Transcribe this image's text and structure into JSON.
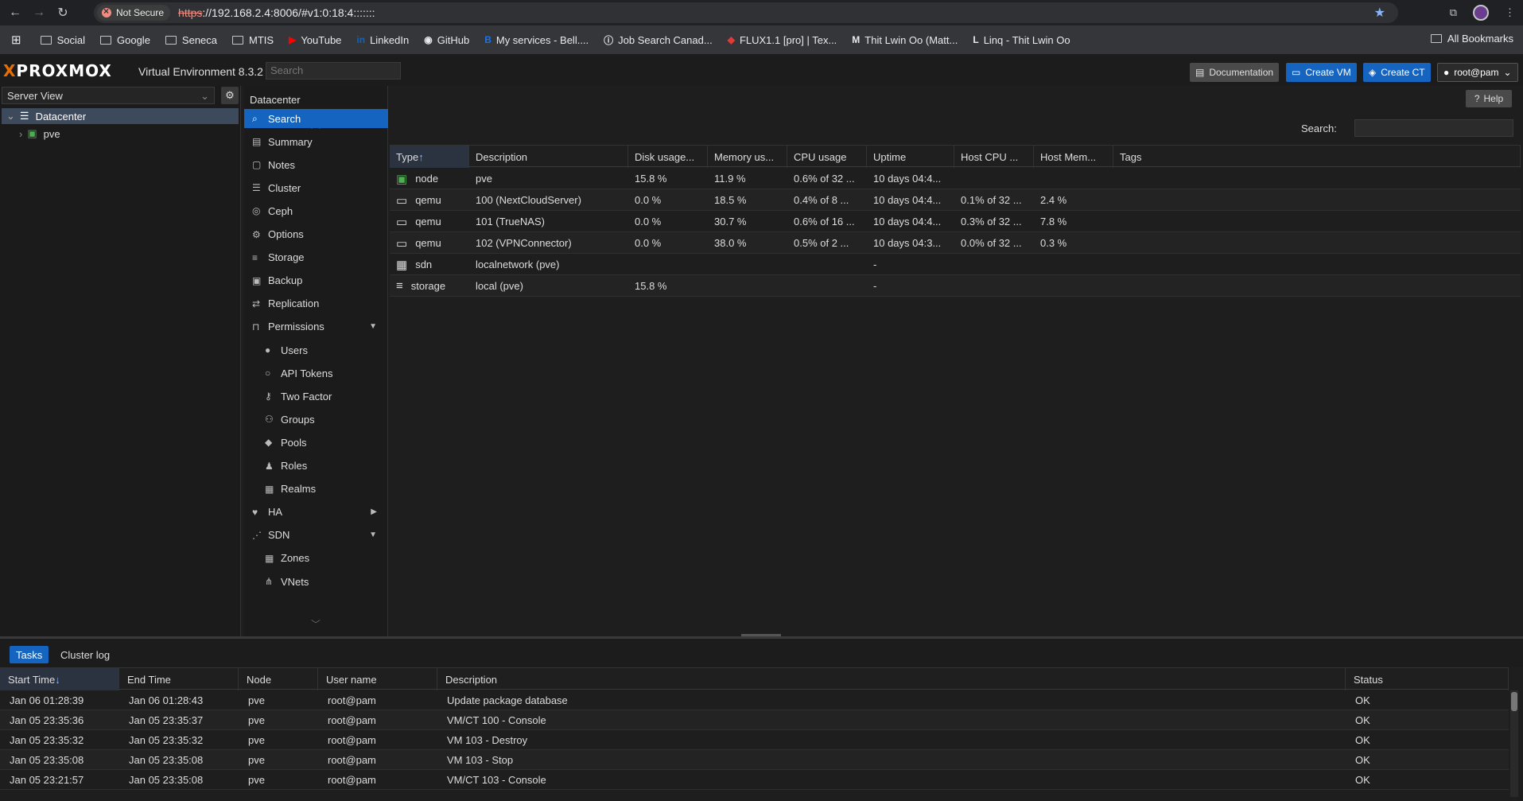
{
  "browser": {
    "not_secure": "Not Secure",
    "url_https": "https",
    "url_rest": "://192.168.2.4:8006/#v1:0:18:4:::::::",
    "bookmarks": [
      {
        "label": "Social",
        "icon": "folder-icon"
      },
      {
        "label": "Google",
        "icon": "folder-icon"
      },
      {
        "label": "Seneca",
        "icon": "folder-icon"
      },
      {
        "label": "MTIS",
        "icon": "folder-icon"
      },
      {
        "label": "YouTube",
        "icon": "youtube-icon"
      },
      {
        "label": "LinkedIn",
        "icon": "linkedin-icon"
      },
      {
        "label": "GitHub",
        "icon": "github-icon"
      },
      {
        "label": "My services - Bell....",
        "icon": "bell-icon"
      },
      {
        "label": "Job Search Canad...",
        "icon": "info-icon"
      },
      {
        "label": "FLUX1.1 [pro] | Tex...",
        "icon": "flux-icon"
      },
      {
        "label": "Thit Lwin Oo (Matt...",
        "icon": "m-icon"
      },
      {
        "label": "Linq - Thit Lwin Oo",
        "icon": "linq-icon"
      }
    ],
    "all_bookmarks": "All Bookmarks"
  },
  "header": {
    "logo": "PROXMOX",
    "version": "Virtual Environment 8.3.2",
    "search_placeholder": "Search",
    "documentation": "Documentation",
    "create_vm": "Create VM",
    "create_ct": "Create CT",
    "user": "root@pam"
  },
  "tree": {
    "view": "Server View",
    "datacenter": "Datacenter",
    "node": "pve"
  },
  "nav": {
    "title": "Datacenter",
    "help": "Help",
    "items": [
      {
        "label": "Search",
        "icon": "search-icon",
        "active": true
      },
      {
        "label": "Summary",
        "icon": "book-icon"
      },
      {
        "label": "Notes",
        "icon": "note-icon"
      },
      {
        "label": "Cluster",
        "icon": "server-icon"
      },
      {
        "label": "Ceph",
        "icon": "ceph-icon"
      },
      {
        "label": "Options",
        "icon": "gear-icon"
      },
      {
        "label": "Storage",
        "icon": "database-icon"
      },
      {
        "label": "Backup",
        "icon": "floppy-icon"
      },
      {
        "label": "Replication",
        "icon": "retweet-icon"
      },
      {
        "label": "Permissions",
        "icon": "unlock-icon",
        "expand": "down"
      },
      {
        "label": "Users",
        "icon": "user-icon",
        "sub": true
      },
      {
        "label": "API Tokens",
        "icon": "user-outline-icon",
        "sub": true
      },
      {
        "label": "Two Factor",
        "icon": "key-icon",
        "sub": true
      },
      {
        "label": "Groups",
        "icon": "users-icon",
        "sub": true
      },
      {
        "label": "Pools",
        "icon": "tags-icon",
        "sub": true
      },
      {
        "label": "Roles",
        "icon": "male-icon",
        "sub": true
      },
      {
        "label": "Realms",
        "icon": "address-book-icon",
        "sub": true
      },
      {
        "label": "HA",
        "icon": "heartbeat-icon",
        "expand": "right"
      },
      {
        "label": "SDN",
        "icon": "sdn-icon",
        "expand": "down"
      },
      {
        "label": "Zones",
        "icon": "th-icon",
        "sub": true
      },
      {
        "label": "VNets",
        "icon": "network-icon",
        "sub": true
      }
    ]
  },
  "resources": {
    "search_label": "Search:",
    "columns": [
      "Type",
      "Description",
      "Disk usage...",
      "Memory us...",
      "CPU usage",
      "Uptime",
      "Host CPU ...",
      "Host Mem...",
      "Tags"
    ],
    "rows": [
      {
        "type": "node",
        "icon": "node-icon",
        "description": "pve",
        "disk": "15.8 %",
        "memory": "11.9 %",
        "cpu": "0.6% of 32 ...",
        "uptime": "10 days 04:4...",
        "host_cpu": "",
        "host_mem": "",
        "tags": ""
      },
      {
        "type": "qemu",
        "icon": "vm-icon",
        "description": "100 (NextCloudServer)",
        "disk": "0.0 %",
        "memory": "18.5 %",
        "cpu": "0.4% of 8 ...",
        "uptime": "10 days 04:4...",
        "host_cpu": "0.1% of 32 ...",
        "host_mem": "2.4 %",
        "tags": ""
      },
      {
        "type": "qemu",
        "icon": "vm-icon",
        "description": "101 (TrueNAS)",
        "disk": "0.0 %",
        "memory": "30.7 %",
        "cpu": "0.6% of 16 ...",
        "uptime": "10 days 04:4...",
        "host_cpu": "0.3% of 32 ...",
        "host_mem": "7.8 %",
        "tags": ""
      },
      {
        "type": "qemu",
        "icon": "vm-icon",
        "description": "102 (VPNConnector)",
        "disk": "0.0 %",
        "memory": "38.0 %",
        "cpu": "0.5% of 2 ...",
        "uptime": "10 days 04:3...",
        "host_cpu": "0.0% of 32 ...",
        "host_mem": "0.3 %",
        "tags": ""
      },
      {
        "type": "sdn",
        "icon": "th-icon",
        "description": "localnetwork (pve)",
        "disk": "",
        "memory": "",
        "cpu": "",
        "uptime": "-",
        "host_cpu": "",
        "host_mem": "",
        "tags": ""
      },
      {
        "type": "storage",
        "icon": "database-icon",
        "description": "local (pve)",
        "disk": "15.8 %",
        "memory": "",
        "cpu": "",
        "uptime": "-",
        "host_cpu": "",
        "host_mem": "",
        "tags": ""
      }
    ]
  },
  "tasks": {
    "tabs": [
      "Tasks",
      "Cluster log"
    ],
    "columns": [
      "Start Time",
      "End Time",
      "Node",
      "User name",
      "Description",
      "Status"
    ],
    "rows": [
      {
        "start": "Jan 06 01:28:39",
        "end": "Jan 06 01:28:43",
        "node": "pve",
        "user": "root@pam",
        "desc": "Update package database",
        "status": "OK"
      },
      {
        "start": "Jan 05 23:35:36",
        "end": "Jan 05 23:35:37",
        "node": "pve",
        "user": "root@pam",
        "desc": "VM/CT 100 - Console",
        "status": "OK"
      },
      {
        "start": "Jan 05 23:35:32",
        "end": "Jan 05 23:35:32",
        "node": "pve",
        "user": "root@pam",
        "desc": "VM 103 - Destroy",
        "status": "OK"
      },
      {
        "start": "Jan 05 23:35:08",
        "end": "Jan 05 23:35:08",
        "node": "pve",
        "user": "root@pam",
        "desc": "VM 103 - Stop",
        "status": "OK"
      },
      {
        "start": "Jan 05 23:21:57",
        "end": "Jan 05 23:35:08",
        "node": "pve",
        "user": "root@pam",
        "desc": "VM/CT 103 - Console",
        "status": "OK"
      }
    ]
  }
}
